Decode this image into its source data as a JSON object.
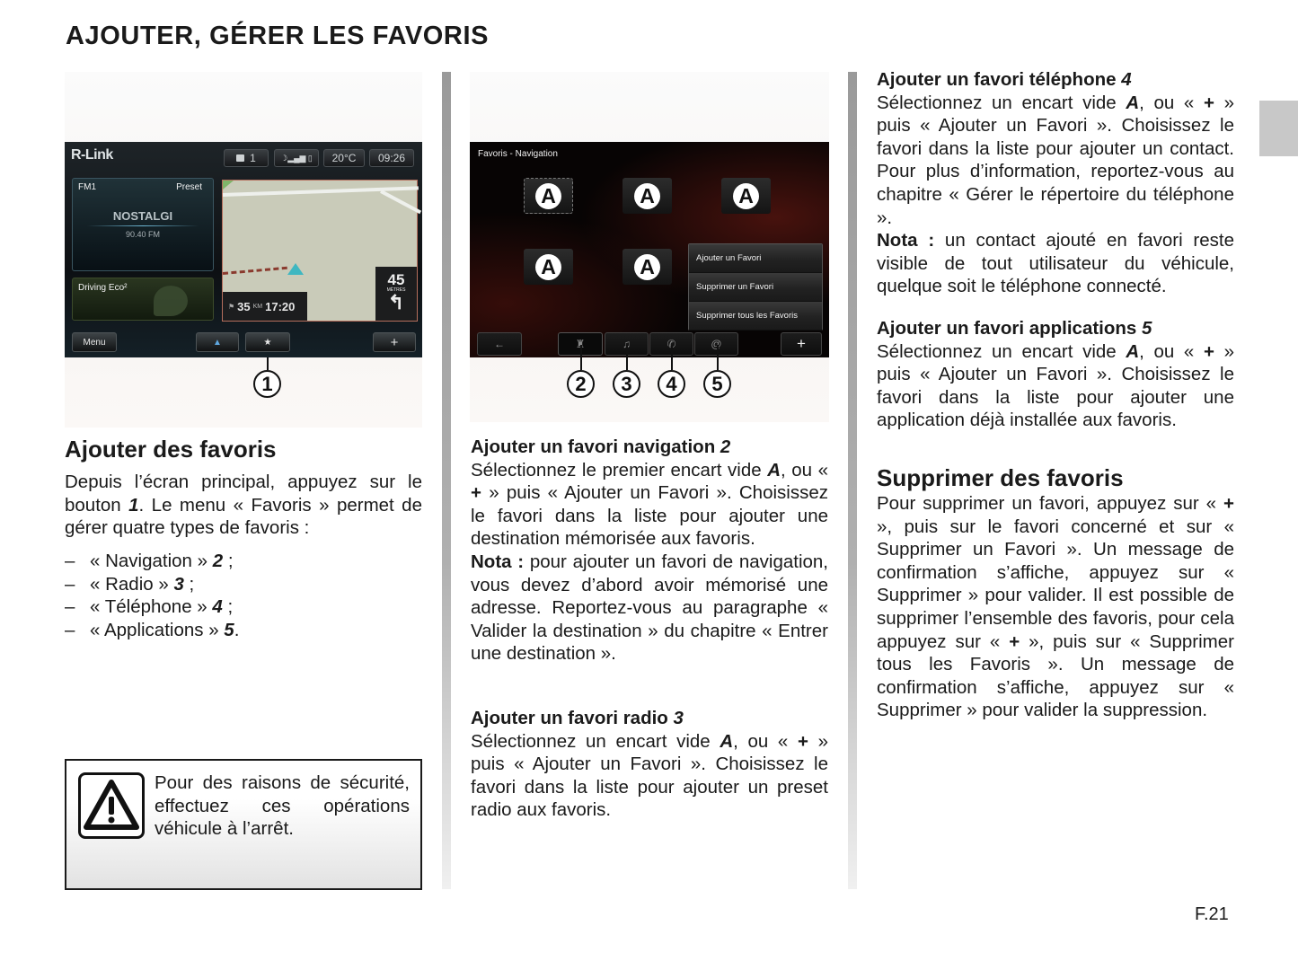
{
  "page": {
    "title": "AJOUTER, GÉRER LES FAVORIS",
    "page_number": "F.21"
  },
  "figure1": {
    "brand": "R-Link",
    "status": {
      "info_count": "1",
      "temperature": "20°C",
      "clock": "09:26"
    },
    "radio": {
      "band": "FM1",
      "preset_label": "Preset",
      "station": "NOSTALGI",
      "frequency": "90.40 FM"
    },
    "eco_label": "Driving Eco²",
    "nav": {
      "distance": "35",
      "distance_unit": "KM",
      "eta": "17:20",
      "turn_distance": "45",
      "turn_unit": "MÈTRES"
    },
    "buttons": {
      "menu": "Menu",
      "plus": "+"
    },
    "callout": "1"
  },
  "figure2": {
    "title": "Favoris - Navigation",
    "slot_label": "A",
    "menu_items": [
      "Ajouter un Favori",
      "Supprimer un Favori",
      "Supprimer tous les Favoris"
    ],
    "plus": "+",
    "callouts": [
      "2",
      "3",
      "4",
      "5"
    ]
  },
  "col1": {
    "heading": "Ajouter des favoris",
    "intro_a": "Depuis l’écran principal, appuyez sur le bouton ",
    "intro_num": "1",
    "intro_b": ". Le menu « Favoris » permet de gérer quatre types de favoris :",
    "list": [
      {
        "dash": "–",
        "text": "« Navigation » ",
        "num": "2",
        "end": " ;"
      },
      {
        "dash": "–",
        "text": "« Radio » ",
        "num": "3",
        "end": " ;"
      },
      {
        "dash": "–",
        "text": "« Téléphone » ",
        "num": "4",
        "end": " ;"
      },
      {
        "dash": "–",
        "text": "« Applications » ",
        "num": "5",
        "end": "."
      }
    ],
    "warning": "Pour des raisons de sécurité, effectuez ces opérations véhicule à l’arrêt."
  },
  "col2": {
    "nav_heading": "Ajouter un favori navigation ",
    "nav_num": "2",
    "nav_a": "Sélectionnez le premier encart vide ",
    "nav_A": "A",
    "nav_b": ", ou « ",
    "nav_plus": "+",
    "nav_c": " » puis « Ajouter un Favori ». Choisissez le favori dans la liste pour ajouter une destination mémorisée aux favoris.",
    "nota_label": "Nota :",
    "nota_text": " pour ajouter un favori de navigation, vous devez d’abord avoir mémorisé une adresse. Reportez-vous au paragraphe « Valider la destination » du chapitre « Entrer une destination ».",
    "radio_heading": "Ajouter un favori radio ",
    "radio_num": "3",
    "radio_a": "Sélectionnez un encart vide ",
    "radio_A": "A",
    "radio_b": ", ou « ",
    "radio_plus": "+",
    "radio_c": " » puis « Ajouter un Favori ». Choisissez le favori dans la liste pour ajouter un preset radio aux favoris."
  },
  "col3": {
    "tel_heading": "Ajouter un favori téléphone ",
    "tel_num": "4",
    "tel_a": "Sélectionnez un encart vide ",
    "tel_A": "A",
    "tel_b": ", ou « ",
    "tel_plus": "+",
    "tel_c": " » puis « Ajouter un Favori ». Choisissez le favori dans la liste pour ajouter un contact. Pour plus d’information, reportez-vous au chapitre « Gérer le répertoire du téléphone ».",
    "tel_nota_label": "Nota :",
    "tel_nota_text": " un contact ajouté en favori reste visible de tout utilisateur du véhicule, quelque soit le téléphone connecté.",
    "app_heading": "Ajouter un favori applications ",
    "app_num": "5",
    "app_a": "Sélectionnez un encart vide ",
    "app_A": "A",
    "app_b": ", ou « ",
    "app_plus": "+",
    "app_c": " » puis « Ajouter un Favori ». Choisissez le favori dans la liste pour ajouter une application déjà installée aux favoris.",
    "del_heading": "Supprimer des favoris",
    "del_a": "Pour supprimer un favori, appuyez sur « ",
    "del_plus1": "+",
    "del_b": " », puis sur le favori concerné et sur « Supprimer un Favori ». Un message de confirmation s’affiche, appuyez sur « Supprimer » pour valider. Il est possible de supprimer l’ensemble des favoris, pour cela appuyez sur « ",
    "del_plus2": "+",
    "del_c": " », puis sur « Supprimer tous les Favoris ». Un message de confirmation s’affiche, appuyez sur « Supprimer » pour valider la suppression."
  }
}
